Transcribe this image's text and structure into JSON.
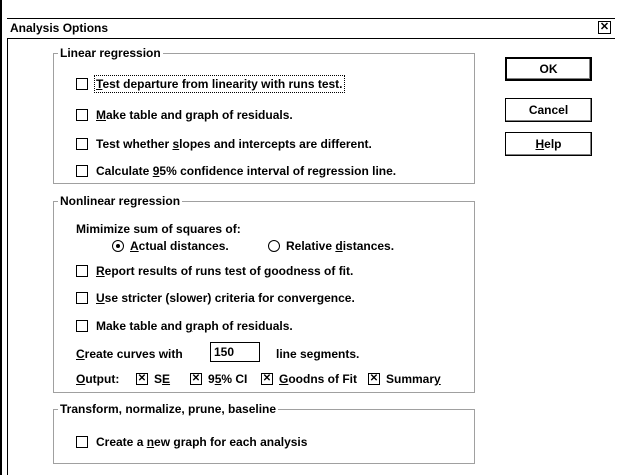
{
  "dialog": {
    "title": "Analysis Options",
    "close_glyph": "✕"
  },
  "buttons": {
    "ok": "OK",
    "cancel": "Cancel",
    "help_pre": "",
    "help_u": "H",
    "help_post": "elp"
  },
  "linear": {
    "title": "Linear regression",
    "items": [
      {
        "pre": "",
        "u": "T",
        "post": "est departure from linearity with runs test.",
        "checked": false
      },
      {
        "pre": "",
        "u": "M",
        "post": "ake table and graph of residuals.",
        "checked": false
      },
      {
        "pre": "Test whether ",
        "u": "s",
        "post": "lopes and intercepts are different.",
        "checked": false
      },
      {
        "pre": "Calculate ",
        "u": "9",
        "post": "5% confidence interval of regression line.",
        "checked": false
      }
    ]
  },
  "nonlinear": {
    "title": "Nonlinear regression",
    "minimize_label": "Mimimize sum of squares of:",
    "radio_actual": {
      "pre": "",
      "u": "A",
      "post": "ctual distances.",
      "selected": true
    },
    "radio_relative": {
      "pre": "Relative ",
      "u": "d",
      "post": "istances.",
      "selected": false
    },
    "items": [
      {
        "pre": "",
        "u": "R",
        "post": "eport results of runs test of goodness of fit.",
        "checked": false
      },
      {
        "pre": "",
        "u": "U",
        "post": "se stricter (slower) criteria for convergence.",
        "checked": false
      },
      {
        "pre": "Make table and ",
        "u": "g",
        "post": "raph of residuals.",
        "checked": false
      }
    ],
    "curves": {
      "pre": "",
      "u": "C",
      "post": "reate curves with",
      "value": "150",
      "suffix": "line segments."
    },
    "output": {
      "label_u": "O",
      "label_post": "utput:",
      "se_pre": "S",
      "se_u": "E",
      "ci_pre": "9",
      "ci_u": "5",
      "ci_post": "% CI",
      "gof_u": "G",
      "gof_post": "oodns of Fit",
      "sum_pre": "Summar",
      "sum_u": "y"
    }
  },
  "transform": {
    "title": "Transform, normalize, prune, baseline",
    "item": {
      "pre": "Create a ",
      "u": "n",
      "post": "ew graph for each analysis",
      "checked": false
    }
  }
}
